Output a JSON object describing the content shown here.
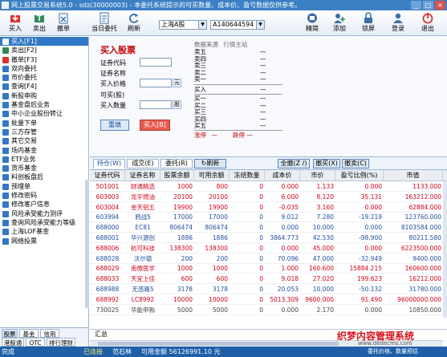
{
  "window": {
    "title": "网上股票交易系统5.0 - sdz(30000003) - 本委托系统提示的可买数量、成本价、盈亏数据仅供参考。"
  },
  "toolbar": {
    "buttons": [
      {
        "label": "买入",
        "icon": "buy-icon"
      },
      {
        "label": "卖出",
        "icon": "sell-icon"
      },
      {
        "label": "撤单",
        "icon": "cancel-order-icon"
      },
      {
        "label": "当日委托",
        "icon": "today-orders-icon"
      },
      {
        "label": "刷新",
        "icon": "refresh-icon"
      },
      {
        "label": "精简",
        "icon": "compact-icon"
      },
      {
        "label": "添加",
        "icon": "add-icon"
      },
      {
        "label": "锁屏",
        "icon": "lock-icon"
      },
      {
        "label": "登录",
        "icon": "login-icon"
      },
      {
        "label": "退出",
        "icon": "exit-icon"
      }
    ],
    "market_select": "上海A股",
    "account_select": "A140644594"
  },
  "sidebar": {
    "items": [
      {
        "label": "买入[F1]",
        "icon": "buy-icon",
        "color": "#d9342b",
        "selected": true
      },
      {
        "label": "卖出[F2]",
        "icon": "sell-icon",
        "color": "#2e8b57"
      },
      {
        "label": "撤单[F3]",
        "icon": "cancel-order-icon",
        "color": "#d9342b"
      },
      {
        "label": "双向委托",
        "icon": "dual-order-icon",
        "color": "#3178c6"
      },
      {
        "label": "市价委托",
        "icon": "market-order-icon",
        "color": "#3178c6"
      },
      {
        "label": "查询[F4]",
        "icon": "query-icon",
        "color": "#3178c6"
      },
      {
        "label": "新股申购",
        "icon": "ipo-icon",
        "color": "#3178c6"
      },
      {
        "label": "基金盘后业务",
        "icon": "fund-icon",
        "color": "#3178c6"
      },
      {
        "label": "中小企业股份转让",
        "icon": "transfer-icon",
        "color": "#3178c6"
      },
      {
        "label": "批量下单",
        "icon": "batch-order-icon",
        "color": "#3178c6"
      },
      {
        "label": "三方存管",
        "icon": "custody-icon",
        "color": "#3178c6"
      },
      {
        "label": "其它交易",
        "icon": "other-trade-icon",
        "color": "#3178c6"
      },
      {
        "label": "场内基金",
        "icon": "fund-icon",
        "color": "#3178c6"
      },
      {
        "label": "ETF业务",
        "icon": "etf-icon",
        "color": "#3178c6"
      },
      {
        "label": "货币基金",
        "icon": "money-fund-icon",
        "color": "#3178c6"
      },
      {
        "label": "料创板盘后",
        "icon": "star-market-icon",
        "color": "#3178c6"
      },
      {
        "label": "预埋单",
        "icon": "preorder-icon",
        "color": "#3178c6"
      },
      {
        "label": "修改密码",
        "icon": "password-icon",
        "color": "#3178c6"
      },
      {
        "label": "修改客户信息",
        "icon": "profile-icon",
        "color": "#3178c6"
      },
      {
        "label": "风险承受能力测评",
        "icon": "risk-icon",
        "color": "#3178c6"
      },
      {
        "label": "查询风险承受能力等级",
        "icon": "risk-level-icon",
        "color": "#3178c6"
      },
      {
        "label": "上海LOF基金",
        "icon": "lof-icon",
        "color": "#3178c6"
      },
      {
        "label": "网络投票",
        "icon": "vote-icon",
        "color": "#3178c6"
      }
    ],
    "bottom_tabs": [
      "股票",
      "基金",
      "信用",
      "港股通",
      "OTC",
      "排行理财"
    ]
  },
  "order": {
    "title": "买入股票",
    "labels": {
      "code": "证券代码",
      "name": "证券名称",
      "price": "买入价格",
      "available": "可买(股)",
      "quantity": "买入数量"
    },
    "price_unit": "元",
    "qty_unit": "股",
    "reset_button": "重填",
    "buy_button": "买入[B]"
  },
  "quote": {
    "tabs": [
      "数据来源",
      "行情主站"
    ],
    "asks": [
      {
        "label": "卖五",
        "value": "—"
      },
      {
        "label": "卖四",
        "value": "—"
      },
      {
        "label": "卖三",
        "value": "—"
      },
      {
        "label": "卖二",
        "value": "—"
      },
      {
        "label": "卖一",
        "value": "—"
      }
    ],
    "last_label": "买入",
    "last_value": "—",
    "bids": [
      {
        "label": "买一",
        "value": "—"
      },
      {
        "label": "买二",
        "value": "—"
      },
      {
        "label": "买三",
        "value": "—"
      },
      {
        "label": "买四",
        "value": "—"
      },
      {
        "label": "买五",
        "value": "—"
      }
    ],
    "limit_up": "涨停",
    "limit_down": "跌停",
    "limit_up_value": "—",
    "limit_down_value": "—"
  },
  "positions": {
    "tabs": [
      "持仓(W)",
      "成交(E)",
      "委托(R)"
    ],
    "refresh_button": "刷新",
    "action_buttons": [
      "全撤(Z /)",
      "撤买(X)",
      "撤卖(C)"
    ],
    "columns": [
      "证券代码",
      "证券名称",
      "股票余额",
      "可用余额",
      "冻结数量",
      "成本价",
      "市价",
      "盈亏比例(%)",
      "市值"
    ],
    "rows": [
      {
        "code": "501001",
        "name": "财通精选",
        "balance": "1000",
        "available": "800",
        "frozen": "0",
        "cost": "0.000",
        "price": "1.133",
        "pnl": "0.000",
        "value": "1133.000",
        "color": "#d0021b"
      },
      {
        "code": "603003",
        "name": "龙宇燃油",
        "balance": "20100",
        "available": "20100",
        "frozen": "0",
        "cost": "6.000",
        "price": "8.120",
        "pnl": "35.131",
        "value": "163212.000",
        "color": "#d0021b"
      },
      {
        "code": "603004",
        "name": "金天铝五",
        "balance": "19900",
        "available": "19900",
        "frozen": "0",
        "cost": "-0.035",
        "price": "3.160",
        "pnl": "0.000",
        "value": "62884.000",
        "color": "#d0021b"
      },
      {
        "code": "603994",
        "name": "鸦战5",
        "balance": "17000",
        "available": "17000",
        "frozen": "0",
        "cost": "9.012",
        "price": "7.280",
        "pnl": "-19.219",
        "value": "123760.000",
        "color": "#1f4e9c"
      },
      {
        "code": "688000",
        "name": "EC81",
        "balance": "806474",
        "available": "806474",
        "frozen": "0",
        "cost": "0.000",
        "price": "10.000",
        "pnl": "0.000",
        "value": "8103584.000",
        "color": "#1f4e9c"
      },
      {
        "code": "688001",
        "name": "华兴源创",
        "balance": "1886",
        "available": "1886",
        "frozen": "0",
        "cost": "3864.773",
        "price": "42.530",
        "pnl": "-98.900",
        "value": "80211.580",
        "color": "#1f4e9c"
      },
      {
        "code": "688006",
        "name": "杭可科技",
        "balance": "138300",
        "available": "138300",
        "frozen": "0",
        "cost": "0.000",
        "price": "45.000",
        "pnl": "0.000",
        "value": "6223500.000",
        "color": "#d0021b"
      },
      {
        "code": "688028",
        "name": "沃尔德",
        "balance": "200",
        "available": "200",
        "frozen": "0",
        "cost": "70.096",
        "price": "47.000",
        "pnl": "-32.949",
        "value": "9400.000",
        "color": "#1f4e9c"
      },
      {
        "code": "688029",
        "name": "南微医学",
        "balance": "1000",
        "available": "1000",
        "frozen": "0",
        "cost": "1.000",
        "price": "160.600",
        "pnl": "15884.215",
        "value": "160600.000",
        "color": "#d0021b"
      },
      {
        "code": "688033",
        "name": "天宜上佳",
        "balance": "600",
        "available": "600",
        "frozen": "0",
        "cost": "9.018",
        "price": "27.020",
        "pnl": "199.623",
        "value": "16212.000",
        "color": "#d0021b"
      },
      {
        "code": "688988",
        "name": "无感路5",
        "balance": "3178",
        "available": "3178",
        "frozen": "0",
        "cost": "20.053",
        "price": "10.000",
        "pnl": "-50.132",
        "value": "31780.000",
        "color": "#1f4e9c"
      },
      {
        "code": "688992",
        "name": "LC8992",
        "balance": "10000",
        "available": "10000",
        "frozen": "0",
        "cost": "5013.309",
        "price": "9600.000",
        "pnl": "91.490",
        "value": "96000000.000",
        "color": "#d0021b"
      },
      {
        "code": "730025",
        "name": "华能申购",
        "balance": "5000",
        "available": "5000",
        "frozen": "0",
        "cost": "0.000",
        "price": "2.170",
        "pnl": "0.000",
        "value": "10850.000",
        "color": "#444444"
      }
    ],
    "total_label": "汇总"
  },
  "status": {
    "left": "完成",
    "connection": "已连接",
    "branch": "范石林",
    "funds": "可用金额 56126991.10 元",
    "right": "委托价格、数量预估"
  },
  "watermark": {
    "text": "织梦内容管理系统",
    "url": "www.dedecms.com"
  },
  "colors": {
    "titlebar": "#3b7fc4",
    "selected": "#3178c6",
    "statusbar": "#1e5fa8",
    "buy_red": "#c00000"
  }
}
